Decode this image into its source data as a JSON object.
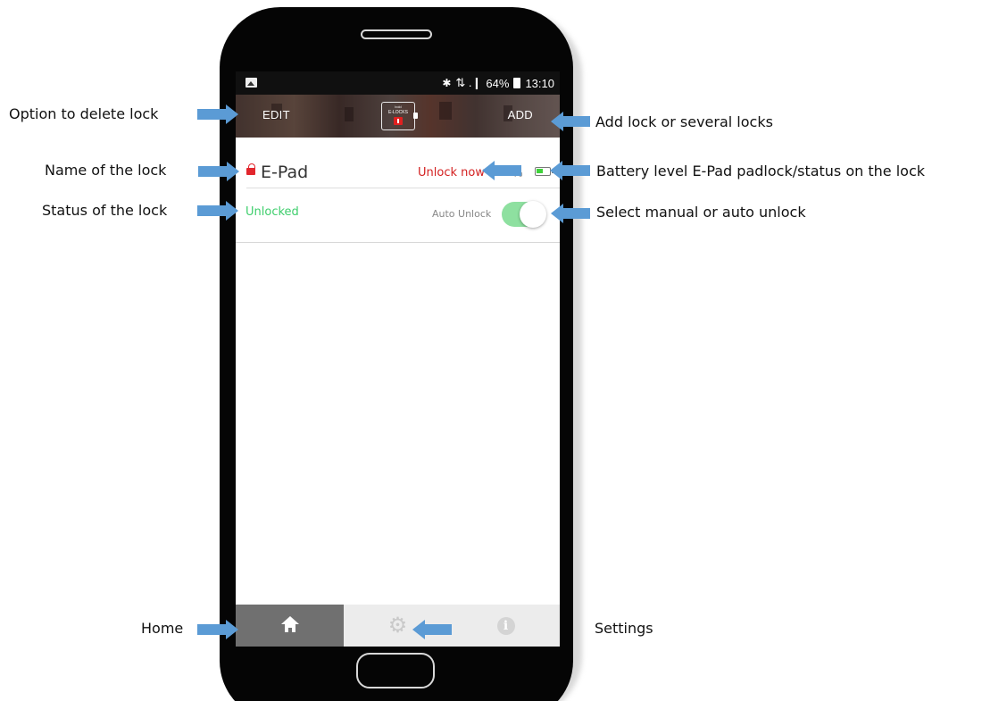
{
  "status_bar": {
    "bluetooth_icon": "bluetooth-icon",
    "signal": "⇅ .❙",
    "battery_percent": "64%",
    "time": "13:10"
  },
  "app_bar": {
    "edit_label": "EDIT",
    "add_label": "ADD",
    "logo_small": "bold",
    "logo_text": "E-LOCKS"
  },
  "lock": {
    "name": "E-Pad",
    "action_label": "Unlock now",
    "battery_percent_visible": "%",
    "battery_level": 0.55,
    "status": "Unlocked",
    "auto_unlock_label": "Auto Unlock",
    "auto_unlock_on": true
  },
  "bottom_nav": {
    "items": [
      {
        "name": "home",
        "icon": "home-icon",
        "active": true
      },
      {
        "name": "settings",
        "icon": "gear-icon",
        "active": false
      },
      {
        "name": "info",
        "icon": "info-icon",
        "active": false
      }
    ]
  },
  "annotations": {
    "delete_lock": "Option to delete lock",
    "lock_name": "Name of the lock",
    "lock_status": "Status of the lock",
    "home": "Home",
    "add_lock": "Add lock or several locks",
    "battery": "Battery level E-Pad padlock/status on the lock",
    "auto_unlock": "Select manual or auto unlock",
    "settings": "Settings"
  },
  "colors": {
    "arrow": "#5b9bd5",
    "lock_red": "#e2262d",
    "status_green": "#3ece6c",
    "toggle_green": "#8ee0a0",
    "battery_green": "#3fd23a"
  }
}
